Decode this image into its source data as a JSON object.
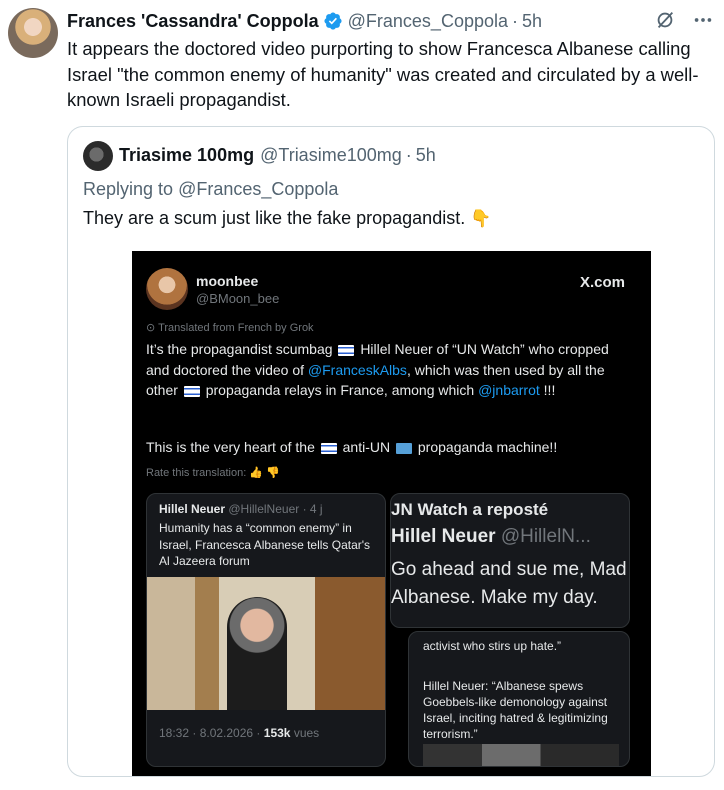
{
  "post": {
    "author_name": "Frances 'Cassandra' Coppola",
    "handle": "@Frances_Coppola",
    "dot": "·",
    "time": "5h",
    "text": "It appears the doctored video purporting to show Francesca Albanese calling Israel \"the common enemy of humanity\" was created and circulated by a well-known Israeli propagandist."
  },
  "quote": {
    "author_name": "Triasime 100mg",
    "handle": "@Triasime100mg",
    "dot": "·",
    "time": "5h",
    "replying_prefix": "Replying to",
    "replying_handle": "@Frances_Coppola",
    "text": "They are a scum just like the fake propagandist.",
    "emoji": "👇"
  },
  "screenshot": {
    "name": "moonbee",
    "handle": "@BMoon_bee",
    "brand": "X.com",
    "translated": "Translated from French by Grok",
    "body_part1": "It’s the propagandist scumbag",
    "body_part2": "Hillel Neuer of “UN Watch” who cropped and doctored the video of",
    "mention1": "@FranceskAlbs",
    "body_part3": ", which was then used by all the other",
    "body_part4": "propaganda relays in France, among which",
    "mention2": "@jnbarrot",
    "body_part5": "!!!",
    "body2_part1": "This is the very heart of the",
    "body2_part2": "anti-UN",
    "body2_part3": "propaganda machine!!",
    "rate": "Rate this translation:",
    "left_card": {
      "name": "Hillel Neuer",
      "handle": "@HillelNeuer · 4 j",
      "text": "Humanity has a “common enemy” in Israel, Francesca Albanese tells Qatar's Al Jazeera forum",
      "meta_time": "18:32 · 8.02.2026 ·",
      "meta_views": "153k",
      "meta_suffix": "vues"
    },
    "right_card": {
      "line1": "JN Watch a reposté",
      "name": "Hillel Neuer",
      "handle": "@HillelN...",
      "line3a": "Go ahead and sue me, Mad",
      "line3b": "Albanese. Make my day."
    },
    "right_card2": {
      "text1": "activist who stirs up hate.”",
      "text2": "Hillel Neuer: “Albanese spews Goebbels-like demonology against Israel, inciting hatred & legitimizing terrorism.”"
    }
  }
}
